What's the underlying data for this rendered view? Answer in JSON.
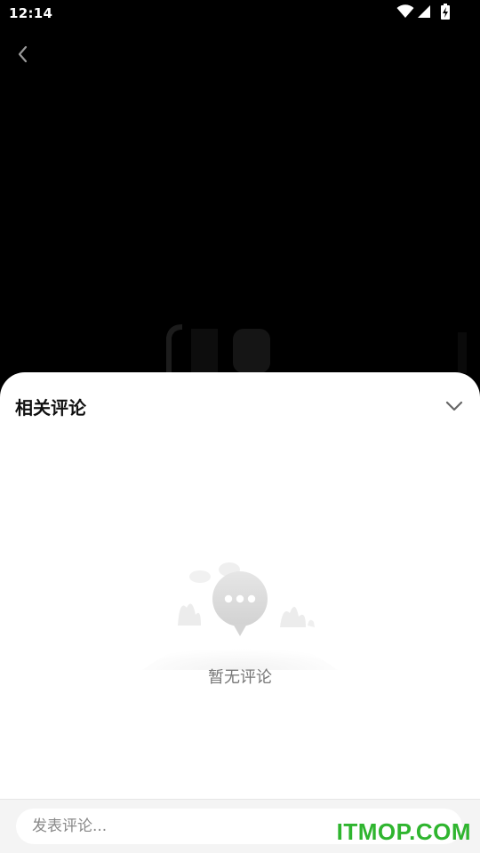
{
  "status_bar": {
    "time": "12:14",
    "icons": [
      "wifi-icon",
      "signal-icon",
      "battery-charging-icon"
    ]
  },
  "nav": {
    "back_icon": "chevron-left-icon"
  },
  "comments_sheet": {
    "title": "相关评论",
    "collapse_icon": "chevron-down-icon",
    "empty_icon": "speech-bubble-icon",
    "empty_text": "暂无评论"
  },
  "comment_bar": {
    "placeholder": "发表评论..."
  },
  "watermark": {
    "text": "ITMOP.COM",
    "color": "#2fb52f"
  },
  "colors": {
    "background": "#000000",
    "sheet": "#ffffff",
    "input_bar": "#f4f4f4"
  }
}
